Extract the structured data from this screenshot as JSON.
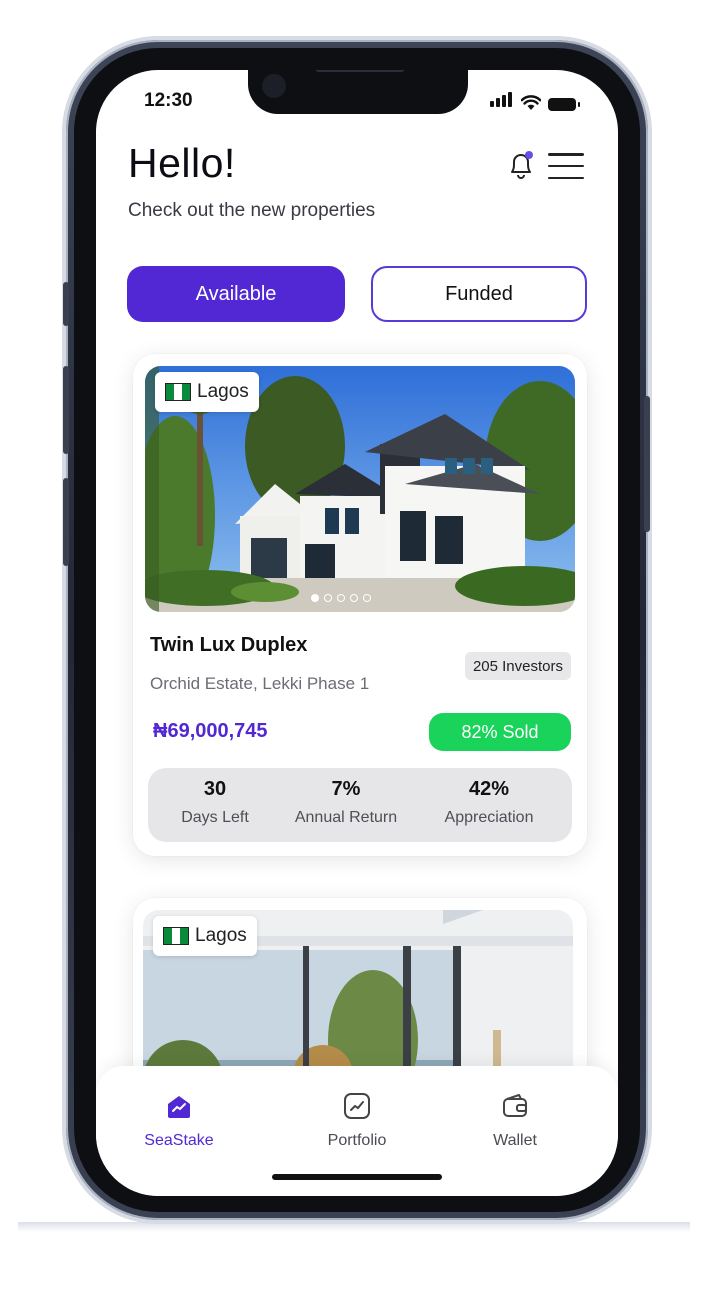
{
  "status_bar": {
    "time": "12:30"
  },
  "header": {
    "greeting": "Hello!",
    "subtitle": "Check out the new properties"
  },
  "tabs": [
    {
      "label": "Available",
      "selected": true
    },
    {
      "label": "Funded",
      "selected": false
    }
  ],
  "colors": {
    "accent": "#5128d4",
    "sold": "#1ad35b",
    "notification_dot": "#6b4de6"
  },
  "properties": [
    {
      "location": "Lagos",
      "title": "Twin Lux Duplex",
      "address": "Orchid Estate, Lekki Phase 1",
      "investors": "205 Investors",
      "price": "₦69,000,745",
      "sold": "82% Sold",
      "image_pages": 5,
      "image_page_active": 1,
      "stats": [
        {
          "value": "30",
          "label": "Days Left"
        },
        {
          "value": "7%",
          "label": "Annual Return"
        },
        {
          "value": "42%",
          "label": "Appreciation"
        }
      ]
    },
    {
      "location": "Lagos"
    }
  ],
  "bottom_nav": [
    {
      "label": "SeaStake",
      "icon": "home-icon",
      "active": true
    },
    {
      "label": "Portfolio",
      "icon": "chart-icon",
      "active": false
    },
    {
      "label": "Wallet",
      "icon": "wallet-icon",
      "active": false
    }
  ]
}
